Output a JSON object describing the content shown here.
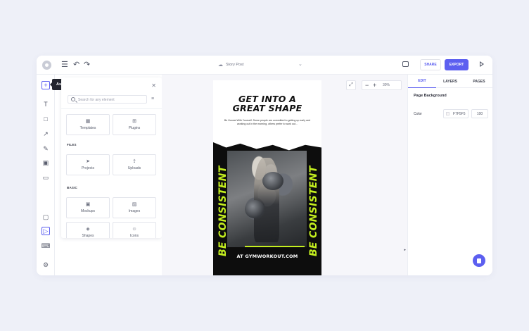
{
  "topbar": {
    "doc_title": "Story Post",
    "share_label": "SHARE",
    "export_label": "EXPORT"
  },
  "tooltip": {
    "label": "Assets panel"
  },
  "assets": {
    "search_placeholder": "Search for any element",
    "top_tiles": [
      {
        "label": "Templates",
        "icon": "templates-icon"
      },
      {
        "label": "Plugins",
        "icon": "plugins-icon"
      }
    ],
    "files_label": "FILES",
    "files_tiles": [
      {
        "label": "Projects",
        "icon": "send-icon"
      },
      {
        "label": "Uploads",
        "icon": "upload-icon"
      }
    ],
    "basic_label": "BASIC",
    "basic_tiles": [
      {
        "label": "Mockups",
        "icon": "mockup-icon"
      },
      {
        "label": "Images",
        "icon": "image-icon"
      },
      {
        "label": "Shapes",
        "icon": "shapes-icon"
      },
      {
        "label": "Icons",
        "icon": "smiley-icon"
      }
    ]
  },
  "canvas": {
    "zoom_value": "30%"
  },
  "poster": {
    "headline_line1": "GET INTO A",
    "headline_line2": "GREAT SHAPE",
    "body": "Be Honest With Yourself. Some people are committed to getting up early and working out in the morning, others prefer to work out...",
    "side_text": "BE CONSISTENT",
    "url": "AT GYMWORKOUT.COM",
    "accent_color": "#c4ef1f"
  },
  "rightpanel": {
    "tabs": [
      "EDIT",
      "LAYERS",
      "PAGES"
    ],
    "active_tab": "EDIT",
    "section_title": "Page Background",
    "color_label": "Color",
    "color_value": "F7F5F5",
    "opacity_value": "100"
  },
  "colors": {
    "accent": "#5c5ff0",
    "background": "#eef0f8"
  }
}
